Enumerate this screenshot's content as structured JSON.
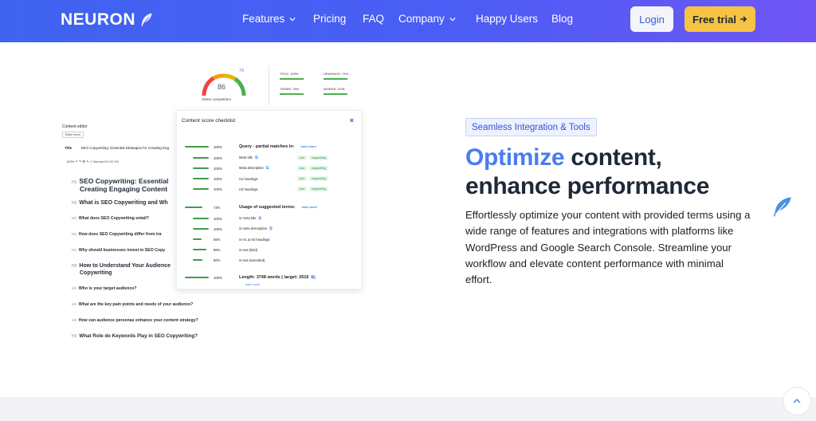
{
  "nav": {
    "logo": "NEURON",
    "items": [
      "Features",
      "Pricing",
      "FAQ",
      "Company",
      "Happy Users",
      "Blog"
    ],
    "login": "Login",
    "trial": "Free trial"
  },
  "illustration": {
    "gauge_score": "86",
    "gauge_label": "Select competitors",
    "wifi_value": "79",
    "stats": [
      "TITLE: 100%",
      "HEADINGS: 71%",
      "TERMS: 76%",
      "WORDS: 3748"
    ],
    "editor_title": "Content editor",
    "editor_menu": "Editor menu",
    "title_label": "Title",
    "title_value": "SEO Copywriting: Essential Strategies for Creating Eng",
    "toolbar": "100%    ↶  ↷   ⌘  ✎  ◇     Normal    H1   H2   H3",
    "headings": [
      {
        "tag": "H1",
        "text": "SEO Copywriting: Essential"
      },
      {
        "tag": "",
        "text": "Creating Engaging Content"
      },
      {
        "tag": "H2",
        "text": "What is SEO Copywriting and Wh"
      },
      {
        "tag": "H3",
        "text": "What does SEO Copywriting entail?"
      },
      {
        "tag": "H3",
        "text": "How does SEO Copywriting differ from tra"
      },
      {
        "tag": "H3",
        "text": "Why should businesses invest in SEO Copy"
      },
      {
        "tag": "H2",
        "text": "How to Understand Your Audience"
      },
      {
        "tag": "",
        "text": "Copywriting"
      },
      {
        "tag": "H3",
        "text": "Who is your target audience?"
      },
      {
        "tag": "H3",
        "text": "What are the key pain points and needs of your audience?"
      },
      {
        "tag": "H3",
        "text": "How can audience personas enhance your content strategy?"
      },
      {
        "tag": "H2",
        "text": "What Role do Keywords Play in SEO Copywriting?"
      }
    ],
    "checklist": {
      "title": "Content score checklist",
      "close": "×",
      "learn_more": "learn more",
      "chips": [
        "seo",
        "copywriting"
      ],
      "sections": [
        {
          "pct": "100%",
          "level": 1.0,
          "label": "Query - partial matches in:"
        },
        {
          "pct": "100%",
          "level": 1.0,
          "label": "Meta title"
        },
        {
          "pct": "100%",
          "level": 1.0,
          "label": "Meta description"
        },
        {
          "pct": "100%",
          "level": 1.0,
          "label": "H1 headings"
        },
        {
          "pct": "100%",
          "level": 1.0,
          "label": "H2 headings"
        },
        {
          "pct": "73%",
          "level": 0.73,
          "label": "Usage of suggested terms:"
        },
        {
          "pct": "100%",
          "level": 1.0,
          "label": "in meta title"
        },
        {
          "pct": "100%",
          "level": 1.0,
          "label": "in meta description"
        },
        {
          "pct": "55%",
          "level": 0.55,
          "label": "in H1 & H2 headings"
        },
        {
          "pct": "86%",
          "level": 0.86,
          "label": "in text (bold)"
        },
        {
          "pct": "60%",
          "level": 0.6,
          "label": "in text (extended)"
        },
        {
          "pct": "100%",
          "level": 1.0,
          "label": "Length: 3748 words ( target: 2616"
        }
      ]
    }
  },
  "content": {
    "badge": "Seamless Integration & Tools",
    "headline_accent": "Optimize",
    "headline_rest1": " content,",
    "headline_line2": "enhance performance",
    "paragraph": "Effortlessly optimize your content with provided terms using a wide range of features and integrations with platforms like WordPress and Google Search Console. Streamline your workflow and elevate content performance with minimal effort."
  },
  "colors": {
    "nav_start": "#3f63f0",
    "nav_end": "#6f56f5",
    "accent": "#4a7bf0",
    "trial_button": "#f6c343",
    "progress_green": "#3f9b4c"
  },
  "icons": [
    "feather-icon",
    "chevron-down-icon",
    "arrow-right-icon",
    "close-icon",
    "external-link-icon",
    "arrow-up-icon"
  ]
}
